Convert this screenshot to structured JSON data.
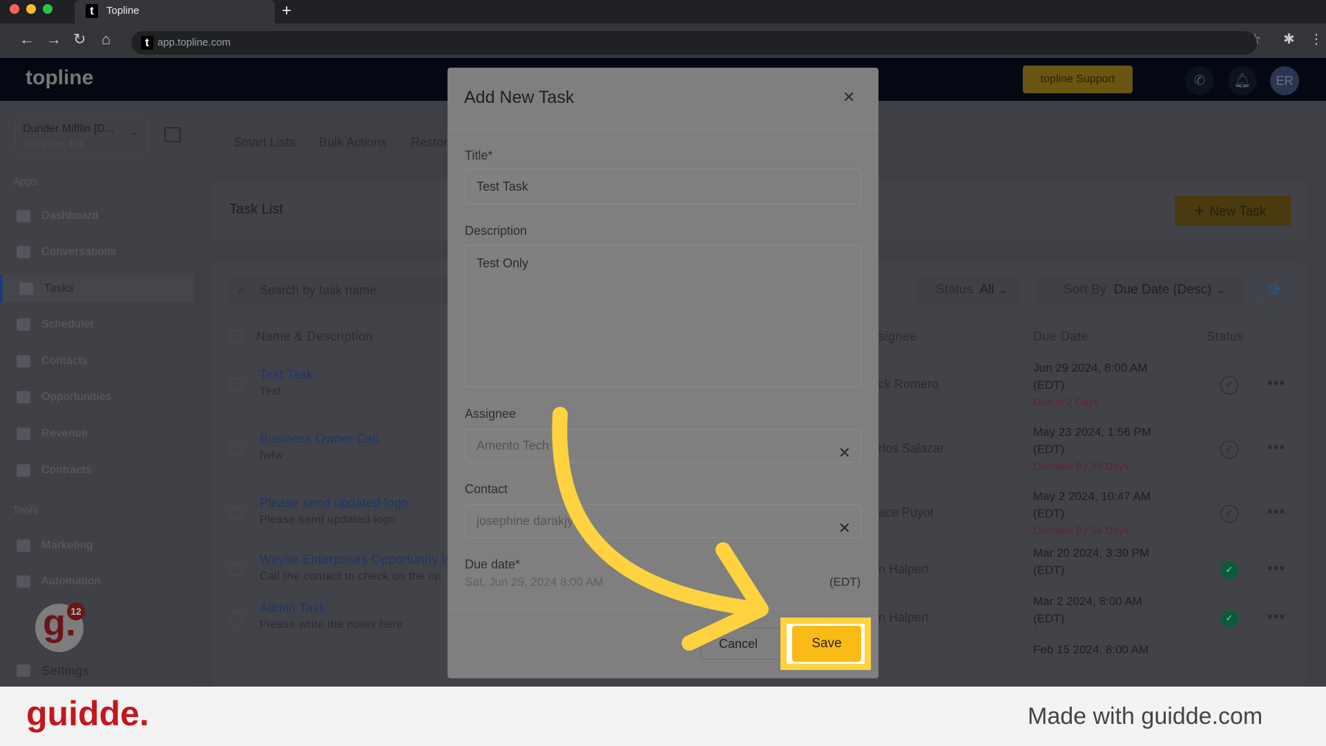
{
  "browser": {
    "tab_title": "Topline",
    "url": "app.topline.com",
    "new_tab": "+"
  },
  "header": {
    "logo": "topline",
    "support_label": "topline Support",
    "avatar": "ER"
  },
  "sidebar": {
    "account_name": "Dunder Mifflin [D...",
    "account_location": "Scranton, PA",
    "apps_label": "Apps",
    "tools_label": "Tools",
    "apps": [
      {
        "label": "Dashboard",
        "icon": "dashboard-icon"
      },
      {
        "label": "Conversations",
        "icon": "chat-icon"
      },
      {
        "label": "Tasks",
        "icon": "tasks-icon",
        "active": true
      },
      {
        "label": "Scheduler",
        "icon": "calendar-icon"
      },
      {
        "label": "Contacts",
        "icon": "person-icon"
      },
      {
        "label": "Opportunities",
        "icon": "target-icon"
      },
      {
        "label": "Revenue",
        "icon": "card-icon"
      },
      {
        "label": "Contracts",
        "icon": "document-icon"
      }
    ],
    "tools": [
      {
        "label": "Marketing",
        "icon": "megaphone-icon"
      },
      {
        "label": "Automation",
        "icon": "gears-icon"
      }
    ],
    "settings_label": "Settings",
    "guidde_badge": "12"
  },
  "top_tabs": [
    "Smart Lists",
    "Bulk Actions",
    "Restor"
  ],
  "task_list": {
    "title": "Task List",
    "new_task_label": "New Task",
    "search_placeholder": "Search by task name",
    "status_filter": {
      "label": "Status",
      "value": "All"
    },
    "sort": {
      "label": "Sort By",
      "value": "Due Date (Desc)"
    },
    "columns": [
      "Name & Description",
      "signee",
      "Due Date",
      "Status"
    ],
    "rows": [
      {
        "name": "Test Task",
        "desc": "Test",
        "assignee": "ck Romero",
        "due": "Jun 29 2024, 8:00 AM",
        "tz": "(EDT)",
        "note": "Due In 2 Days",
        "done": false
      },
      {
        "name": "Business Owner Call",
        "desc": "fwfw",
        "assignee": "rlos Salazar",
        "due": "May 23 2024, 1:56 PM",
        "tz": "(EDT)",
        "note": "Overdue By 35 Days",
        "done": false
      },
      {
        "name": "Please send updated logo",
        "desc": "Please send updated logo",
        "assignee": "ace Puyot",
        "due": "May 2 2024, 10:47 AM",
        "tz": "(EDT)",
        "note": "Overdue By 56 Days",
        "done": false
      },
      {
        "name": "Wayne Enterprises Opportunity Is",
        "desc": "Call the contact to check on the op",
        "assignee": "n Halpert",
        "due": "Mar 20 2024, 3:30 PM",
        "tz": "(EDT)",
        "note": "",
        "done": true
      },
      {
        "name": "Admin Task",
        "desc": "Please write the notes here",
        "assignee": "n Halpert",
        "due": "Mar 2 2024, 8:00 AM",
        "tz": "(EDT)",
        "note": "",
        "done": true
      },
      {
        "name": "",
        "desc": "",
        "assignee": "",
        "due": "Feb 15 2024, 8:00 AM",
        "tz": "",
        "note": "",
        "done": null
      }
    ]
  },
  "dialog": {
    "title": "Add New Task",
    "title_label": "Title*",
    "title_value": "Test Task",
    "description_label": "Description",
    "description_value": "Test Only",
    "assignee_label": "Assignee",
    "assignee_value": "Amento Tech",
    "contact_label": "Contact",
    "contact_value": "josephine darakjy",
    "due_label": "Due date*",
    "due_value": "Sat, Jun 29, 2024 8:00 AM",
    "due_tz": "(EDT)",
    "cancel_label": "Cancel",
    "save_label": "Save"
  },
  "footer": {
    "logo": "guidde.",
    "made_with": "Made with guidde.com"
  },
  "colors": {
    "highlight": "#ffd23f",
    "save": "#fbbb16",
    "brand_red": "#c4161c"
  }
}
